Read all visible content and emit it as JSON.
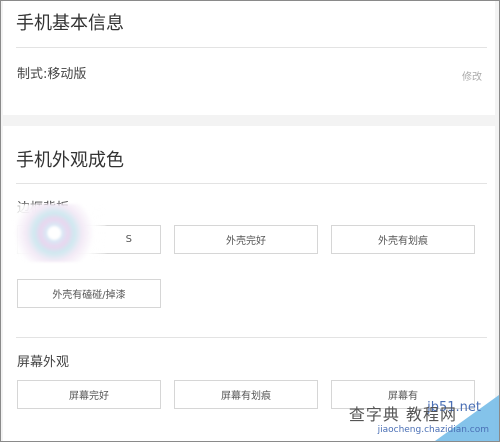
{
  "section_basic": {
    "title": "手机基本信息",
    "spec_label": "制式:移动版",
    "edit_label": "修改"
  },
  "section_appearance": {
    "title": "手机外观成色",
    "frame_label": "边框背板",
    "frame_options": [
      "外壳完好",
      "外壳有划痕",
      "外壳有磕碰/掉漆"
    ],
    "frame_first_option_partial": "S",
    "screen_label": "屏幕外观",
    "screen_options": [
      "屏幕完好",
      "屏幕有划痕",
      "屏幕有"
    ]
  },
  "watermark": {
    "text_main": "查字典 教程网",
    "site": "jb51.net",
    "sub": "jiaocheng.chazidian.com"
  }
}
